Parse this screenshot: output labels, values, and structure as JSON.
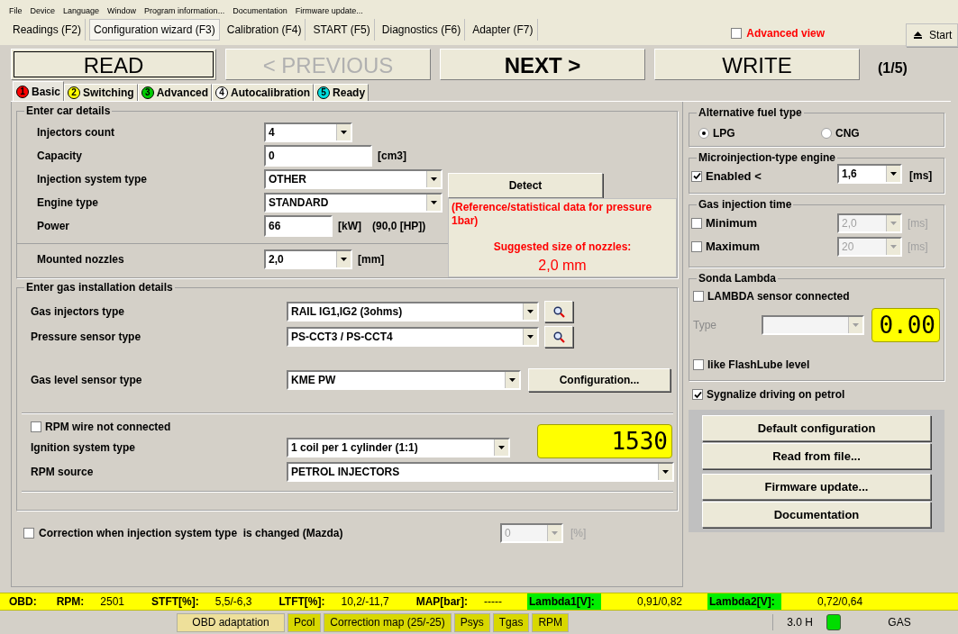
{
  "menu": [
    "File",
    "Device",
    "Language",
    "Window",
    "Program information...",
    "Documentation",
    "Firmware update..."
  ],
  "main_tabs": [
    {
      "label": "Readings (F2)",
      "selected": false
    },
    {
      "label": "Configuration wizard (F3)",
      "selected": true
    },
    {
      "label": "Calibration (F4)",
      "selected": false
    },
    {
      "label": "START (F5)",
      "selected": false
    },
    {
      "label": "Diagnostics (F6)",
      "selected": false
    },
    {
      "label": "Adapter (F7)",
      "selected": false
    }
  ],
  "advanced_view": {
    "label": "Advanced view",
    "checked": false
  },
  "start_button": {
    "label": "Start"
  },
  "wizard_buttons": [
    {
      "label": "READ",
      "disabled": false,
      "focused": true,
      "bold": false
    },
    {
      "label": "< PREVIOUS",
      "disabled": true,
      "focused": false,
      "bold": false
    },
    {
      "label": "NEXT >",
      "disabled": false,
      "focused": false,
      "bold": true
    },
    {
      "label": "WRITE",
      "disabled": false,
      "focused": false,
      "bold": false
    }
  ],
  "step": "(1/5)",
  "step_tabs": [
    {
      "number": "1",
      "label": "Basic",
      "color": "#ff0000",
      "selected": true
    },
    {
      "number": "2",
      "label": "Switching",
      "color": "#ffff00",
      "selected": false
    },
    {
      "number": "3",
      "label": "Advanced",
      "color": "#00cc00",
      "selected": false
    },
    {
      "number": "4",
      "label": "Autocalibration",
      "color": "#ffffff",
      "selected": false
    },
    {
      "number": "5",
      "label": "Ready",
      "color": "#00e0e0",
      "selected": false
    }
  ],
  "car_details": {
    "title": "Enter car details",
    "rows": [
      {
        "kind": "select",
        "label": "Injectors count",
        "value": "4",
        "unit": "",
        "extra": ""
      },
      {
        "kind": "input",
        "label": "Capacity",
        "value": "0",
        "unit": "[cm3]",
        "extra": ""
      },
      {
        "kind": "wide_select",
        "label": "Injection system type",
        "value": "OTHER",
        "unit": "",
        "extra": ""
      },
      {
        "kind": "wide_select",
        "label": "Engine type",
        "value": "STANDARD",
        "unit": "",
        "extra": ""
      },
      {
        "kind": "short_input",
        "label": "Power",
        "value": "66",
        "unit": "[kW]",
        "extra": "(90,0 [HP])"
      },
      {
        "kind": "select",
        "label": "Mounted nozzles",
        "value": "2,0",
        "unit": "[mm]",
        "extra": ""
      }
    ],
    "detect_button": "Detect",
    "note": "(Reference/statistical data for pressure 1bar)",
    "suggested_label": "Suggested size of nozzles:",
    "suggested_value": "2,0 mm"
  },
  "gas_details": {
    "title": "Enter gas installation details",
    "rows": [
      {
        "label": "Gas injectors type",
        "value": "RAIL IG1,IG2 (3ohms)",
        "button": {
          "kind": "search"
        }
      },
      {
        "label": "Pressure sensor type",
        "value": "PS-CCT3 / PS-CCT4",
        "button": {
          "kind": "search"
        }
      },
      {
        "label": "Gas level sensor type",
        "value": "KME PW",
        "button": {
          "kind": "text",
          "label": "Configuration..."
        }
      }
    ],
    "rpm_wire": {
      "label": "RPM wire not connected",
      "checked": false
    },
    "ignition": {
      "label": "Ignition system type",
      "value": "1 coil per 1 cylinder (1:1)"
    },
    "rpm_display": "1530",
    "rpm_source": {
      "label": "RPM source",
      "value": "PETROL INJECTORS"
    }
  },
  "correction": {
    "label": "Correction when injection system type  is changed (Mazda)",
    "checked": false,
    "value": "0",
    "unit": "[%]"
  },
  "fuel_type": {
    "title": "Alternative fuel type",
    "options": [
      {
        "label": "LPG",
        "selected": true
      },
      {
        "label": "CNG",
        "selected": false
      }
    ]
  },
  "microinjection": {
    "title": "Microinjection-type engine",
    "label": "Enabled <",
    "checked": true,
    "value": "1,6",
    "unit": "[ms]"
  },
  "gas_injection_time": {
    "title": "Gas injection time",
    "rows": [
      {
        "label": "Minimum",
        "checked": false,
        "value": "2,0",
        "unit": "[ms]"
      },
      {
        "label": "Maximum",
        "checked": false,
        "value": "20",
        "unit": "[ms]"
      }
    ]
  },
  "lambda": {
    "title": "Sonda Lambda",
    "connected": {
      "label": "LAMBDA sensor connected",
      "checked": false
    },
    "type_label": "Type",
    "display": "0.00",
    "flashlube": {
      "label": "like FlashLube level",
      "checked": false
    }
  },
  "signalize": {
    "label": "Sygnalize driving on petrol",
    "checked": true
  },
  "actions": [
    "Default configuration",
    "Read from file...",
    "Firmware update...",
    "Documentation"
  ],
  "obd": {
    "title": "OBD:",
    "items": [
      {
        "label": "RPM:",
        "value": "2501",
        "highlighted": false
      },
      {
        "label": "STFT[%]:",
        "value": "5,5/-6,3",
        "highlighted": false
      },
      {
        "label": "LTFT[%]:",
        "value": "10,2/-11,7",
        "highlighted": false
      },
      {
        "label": "MAP[bar]:",
        "value": "-----",
        "highlighted": false
      },
      {
        "label": "Lambda1[V]:",
        "value": "0,91/0,82",
        "highlighted": true
      },
      {
        "label": "Lambda2[V]:",
        "value": "0,72/0,64",
        "highlighted": true
      }
    ]
  },
  "status": {
    "buttons": [
      {
        "label": "OBD adaptation",
        "color": "#eee09a"
      },
      {
        "label": "Pcol",
        "color": "#d8d800"
      },
      {
        "label": "Correction map (25/-25)",
        "color": "#d8d800"
      },
      {
        "label": "Psys",
        "color": "#d8d800"
      },
      {
        "label": "Tgas",
        "color": "#d8d800"
      },
      {
        "label": "RPM",
        "color": "#d8d800"
      }
    ],
    "version": "3.0 H",
    "indicator_on": true,
    "mode": "GAS"
  }
}
